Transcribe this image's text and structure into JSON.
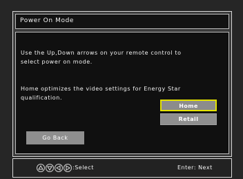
{
  "dialog": {
    "title": "Power On Mode",
    "desc_line1": "Use the Up,Down arrows on your remote control to",
    "desc_line2": "select power on mode.",
    "desc_line3": "Home optimizes the video settings for Energy Star",
    "desc_line4": "qualification."
  },
  "options": [
    {
      "label": "Home",
      "selected": true
    },
    {
      "label": "Retail",
      "selected": false
    }
  ],
  "go_back_label": "Go Back",
  "footer": {
    "arrow_icons": [
      "up-arrow-icon",
      "down-arrow-icon",
      "left-arrow-icon",
      "right-arrow-icon"
    ],
    "select_label": ":Select",
    "enter_label": "Enter: Next"
  },
  "colors": {
    "selected_border": "#e4e300",
    "button_fill": "#8f8f8f",
    "panel_bg": "#101010"
  }
}
